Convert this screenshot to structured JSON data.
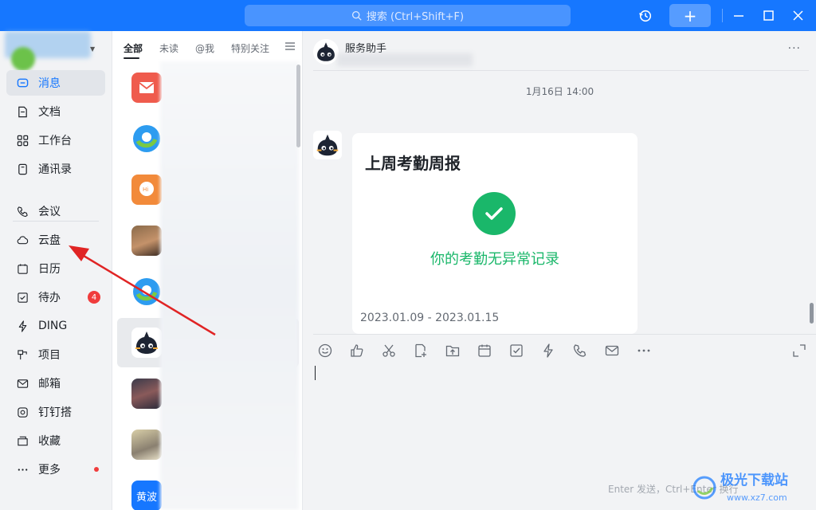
{
  "titlebar": {
    "search_placeholder": "搜索 (Ctrl+Shift+F)",
    "accent": "#1677ff"
  },
  "sidebar": {
    "items": [
      {
        "label": "消息",
        "icon": "message-icon",
        "active": true
      },
      {
        "label": "文档",
        "icon": "document-icon"
      },
      {
        "label": "工作台",
        "icon": "workbench-icon"
      },
      {
        "label": "通讯录",
        "icon": "contacts-icon"
      },
      {
        "label": "会议",
        "icon": "phone-icon"
      },
      {
        "label": "云盘",
        "icon": "cloud-icon"
      },
      {
        "label": "日历",
        "icon": "calendar-icon"
      },
      {
        "label": "待办",
        "icon": "todo-icon",
        "badge": "4"
      },
      {
        "label": "DING",
        "icon": "lightning-icon"
      },
      {
        "label": "项目",
        "icon": "project-icon"
      },
      {
        "label": "邮箱",
        "icon": "mail-icon"
      },
      {
        "label": "钉钉搭",
        "icon": "builder-icon"
      },
      {
        "label": "收藏",
        "icon": "favorite-icon"
      },
      {
        "label": "更多",
        "icon": "more-icon",
        "dot": true
      }
    ]
  },
  "conversations": {
    "tabs": [
      "全部",
      "未读",
      "@我",
      "特别关注"
    ],
    "last_avatar_text": "黄波"
  },
  "chat": {
    "title": "服务助手",
    "timestamp": "1月16日 14:00",
    "card": {
      "title": "上周考勤周报",
      "status": "你的考勤无异常记录",
      "date_range": "2023.01.09 - 2023.01.15"
    },
    "input_hint": "Enter 发送，Ctrl+Enter 换行",
    "success_color": "#1ab76a"
  },
  "watermark": {
    "brand": "极光下载站",
    "url": "www.xz7.com"
  }
}
